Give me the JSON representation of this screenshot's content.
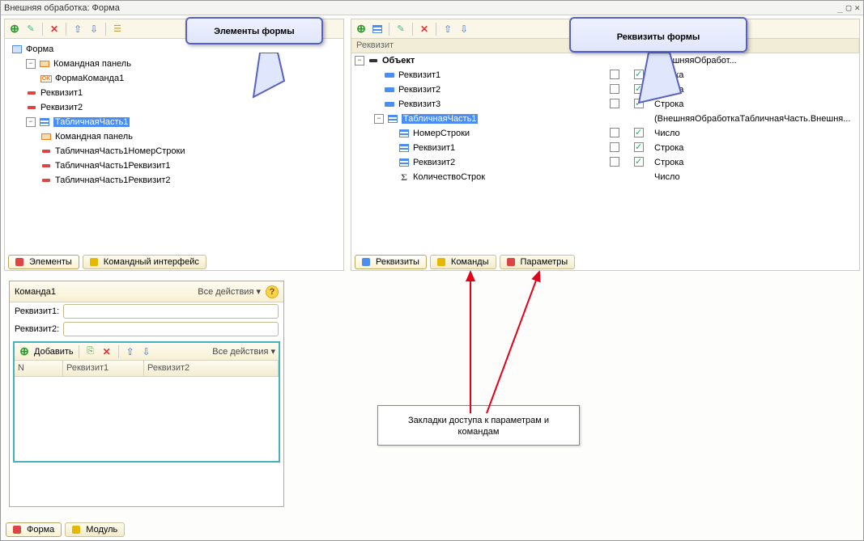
{
  "window": {
    "title": "Внешняя обработка: Форма"
  },
  "callout": {
    "elements": "Элементы формы",
    "attrs": "Реквизиты формы",
    "tabs_info": "Закладки доступа к параметрам и командам"
  },
  "leftTree": {
    "form": "Форма",
    "cmdPanel": "Командная панель",
    "formCmd1": "ФормаКоманда1",
    "rek1": "Реквизит1",
    "rek2": "Реквизит2",
    "tab1": "ТабличнаяЧасть1",
    "cmdPanel2": "Командная панель",
    "tab1Nom": "ТабличнаяЧасть1НомерСтроки",
    "tab1R1": "ТабличнаяЧасть1Реквизит1",
    "tab1R2": "ТабличнаяЧасть1Реквизит2"
  },
  "leftTabs": {
    "el": "Элементы",
    "ci": "Командный интерфейс"
  },
  "rightHead": "Реквизит",
  "rightTree": {
    "obj": "Объект",
    "type_obj": ".ВнешняяОбработ...",
    "r1": "Реквизит1",
    "t1": "Строка",
    "r2": "Реквизит2",
    "t2": "Строка",
    "r3": "Реквизит3",
    "t3": "Строка",
    "tp1": "ТабличнаяЧасть1",
    "tpt": "(ВнешняяОбработкаТабличнаяЧасть.Внешня...",
    "nom": "НомерСтроки",
    "nomt": "Число",
    "tr1": "Реквизит1",
    "trt1": "Строка",
    "tr2": "Реквизит2",
    "trt2": "Строка",
    "ks": "КоличествоСтрок",
    "kst": "Число"
  },
  "rightTabs": {
    "rek": "Реквизиты",
    "kom": "Команды",
    "par": "Параметры"
  },
  "preview": {
    "cmd1": "Команда1",
    "all": "Все действия",
    "rek1l": "Реквизит1:",
    "rek2l": "Реквизит2:",
    "add": "Добавить",
    "colN": "N",
    "colR1": "Реквизит1",
    "colR2": "Реквизит2"
  },
  "footer": {
    "forma": "Форма",
    "modul": "Модуль"
  }
}
